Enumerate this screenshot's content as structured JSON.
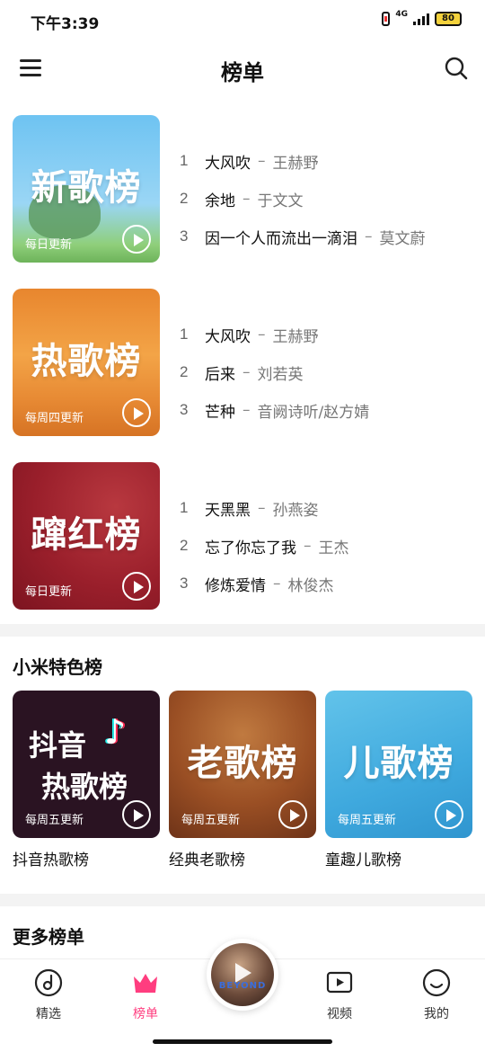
{
  "status": {
    "time": "下午3:39",
    "network": "4G",
    "battery": "80"
  },
  "header": {
    "title": "榜单"
  },
  "charts": [
    {
      "cover_title": "新歌榜",
      "update": "每日更新",
      "songs": [
        {
          "rank": "1",
          "name": "大风吹",
          "artist": "王赫野"
        },
        {
          "rank": "2",
          "name": "余地",
          "artist": "于文文"
        },
        {
          "rank": "3",
          "name": "因一个人而流出一滴泪",
          "artist": "莫文蔚"
        }
      ]
    },
    {
      "cover_title": "热歌榜",
      "update": "每周四更新",
      "songs": [
        {
          "rank": "1",
          "name": "大风吹",
          "artist": "王赫野"
        },
        {
          "rank": "2",
          "name": "后来",
          "artist": "刘若英"
        },
        {
          "rank": "3",
          "name": "芒种",
          "artist": "音阙诗听/赵方婧"
        }
      ]
    },
    {
      "cover_title": "蹿红榜",
      "update": "每日更新",
      "songs": [
        {
          "rank": "1",
          "name": "天黑黑",
          "artist": "孙燕姿"
        },
        {
          "rank": "2",
          "name": "忘了你忘了我",
          "artist": "王杰"
        },
        {
          "rank": "3",
          "name": "修炼爱情",
          "artist": "林俊杰"
        }
      ]
    }
  ],
  "special": {
    "title": "小米特色榜",
    "cards": [
      {
        "cover_line1": "抖音",
        "cover_line2": "热歌榜",
        "update": "每周五更新",
        "name": "抖音热歌榜"
      },
      {
        "cover_title": "老歌榜",
        "update": "每周五更新",
        "name": "经典老歌榜"
      },
      {
        "cover_title": "儿歌榜",
        "update": "每周五更新",
        "name": "童趣儿歌榜"
      }
    ]
  },
  "more": {
    "title": "更多榜单"
  },
  "player": {
    "disc_text": "BEYOND"
  },
  "nav": [
    {
      "label": "精选"
    },
    {
      "label": "榜单"
    },
    {
      "label": "视频"
    },
    {
      "label": "我的"
    }
  ],
  "colors": {
    "accent": "#ff3d7f"
  }
}
